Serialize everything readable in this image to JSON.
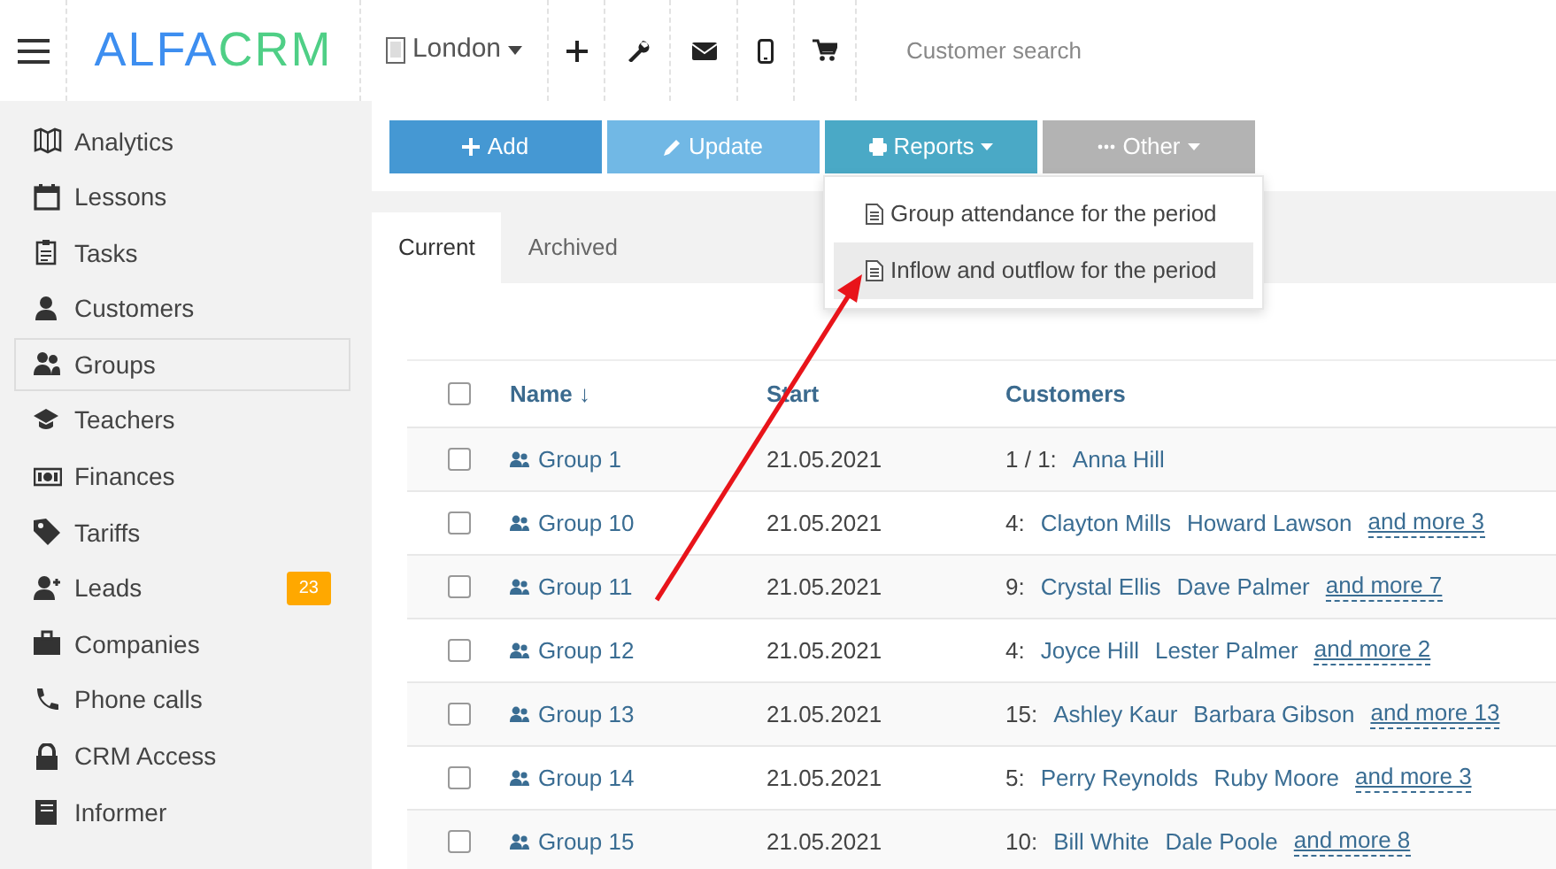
{
  "header": {
    "logo": {
      "part_1": "ALFA",
      "part_2": "CRM"
    },
    "branch": "London",
    "search": {
      "placeholder": "Customer search"
    }
  },
  "sidebar": {
    "items": [
      {
        "label": "Analytics",
        "selected": false
      },
      {
        "label": "Lessons",
        "selected": false
      },
      {
        "label": "Tasks",
        "selected": false
      },
      {
        "label": "Customers",
        "selected": false
      },
      {
        "label": "Groups",
        "selected": true
      },
      {
        "label": "Teachers",
        "selected": false
      },
      {
        "label": "Finances",
        "selected": false
      },
      {
        "label": "Tariffs",
        "selected": false
      },
      {
        "label": "Leads",
        "selected": false,
        "badge": "23"
      },
      {
        "label": "Companies",
        "selected": false
      },
      {
        "label": "Phone calls",
        "selected": false
      },
      {
        "label": "CRM Access",
        "selected": false
      },
      {
        "label": "Informer",
        "selected": false
      }
    ]
  },
  "toolbar": {
    "buttons": [
      {
        "label": "Add",
        "kind": "add"
      },
      {
        "label": "Update",
        "kind": "update"
      },
      {
        "label": "Reports",
        "kind": "reports"
      },
      {
        "label": "Other",
        "kind": "other"
      }
    ]
  },
  "reports_menu": {
    "items": [
      {
        "label": "Group attendance for the period",
        "selected": false
      },
      {
        "label": "Inflow and outflow for the period",
        "selected": true
      }
    ]
  },
  "tabs": [
    {
      "label": "Current",
      "selected": true
    },
    {
      "label": "Archived",
      "selected": false
    }
  ],
  "table": {
    "all_checked": false,
    "columns": [
      "Name ↓",
      "Start",
      "Customers"
    ],
    "rows": [
      {
        "checked": false,
        "name": "Group 1",
        "start": "21.05.2021",
        "count": "1 / 1:",
        "customers": [
          "Anna Hill"
        ]
      },
      {
        "checked": false,
        "name": "Group 10",
        "start": "21.05.2021",
        "count": "4:",
        "customers": [
          "Clayton Mills",
          "Howard Lawson"
        ],
        "more": "and more 3"
      },
      {
        "checked": false,
        "name": "Group 11",
        "start": "21.05.2021",
        "count": "9:",
        "customers": [
          "Crystal Ellis",
          "Dave Palmer"
        ],
        "more": "and more 7"
      },
      {
        "checked": false,
        "name": "Group 12",
        "start": "21.05.2021",
        "count": "4:",
        "customers": [
          "Joyce Hill",
          "Lester Palmer"
        ],
        "more": "and more 2"
      },
      {
        "checked": false,
        "name": "Group 13",
        "start": "21.05.2021",
        "count": "15:",
        "customers": [
          "Ashley Kaur",
          "Barbara Gibson"
        ],
        "more": "and more 13"
      },
      {
        "checked": false,
        "name": "Group 14",
        "start": "21.05.2021",
        "count": "5:",
        "customers": [
          "Perry Reynolds",
          "Ruby Moore"
        ],
        "more": "and more 3"
      },
      {
        "checked": false,
        "name": "Group 15",
        "start": "21.05.2021",
        "count": "10:",
        "customers": [
          "Bill White",
          "Dale Poole"
        ],
        "more": "and more 8"
      }
    ]
  }
}
